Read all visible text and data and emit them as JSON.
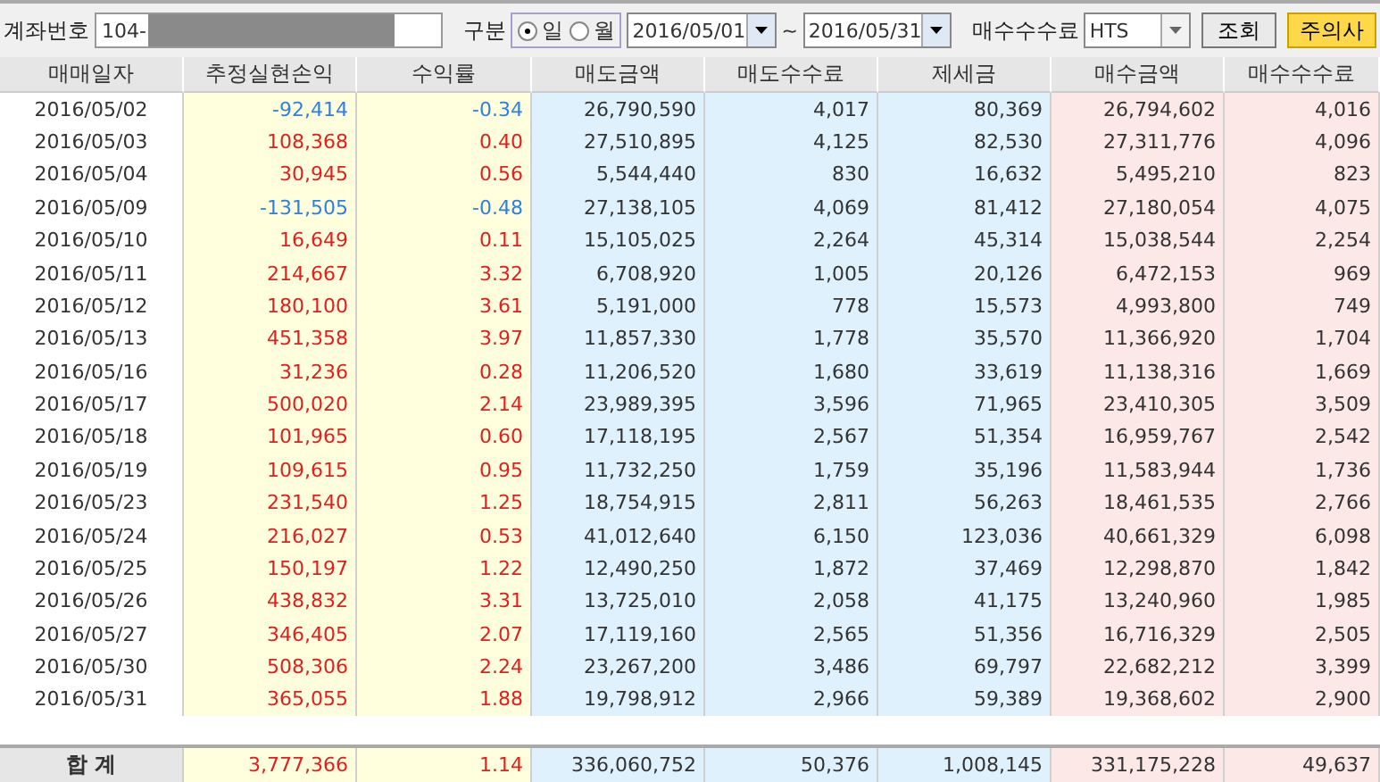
{
  "toolbar": {
    "account_label": "계좌번호",
    "account_value": "104-",
    "type_label": "구분",
    "period_options": [
      {
        "label": "일",
        "selected": true
      },
      {
        "label": "월",
        "selected": false
      }
    ],
    "date_from": "2016/05/01",
    "date_sep": "~",
    "date_to": "2016/05/31",
    "fee_label": "매수수수료",
    "fee_value": "HTS",
    "query_button": "조회",
    "notice_button": "주의사"
  },
  "table": {
    "columns": [
      "매매일자",
      "추정실현손익",
      "수익률",
      "매도금액",
      "매도수수료",
      "제세금",
      "매수금액",
      "매수수수료"
    ],
    "rows": [
      {
        "kind": "loss",
        "cells": [
          "2016/05/02",
          "-92,414",
          "-0.34",
          "26,790,590",
          "4,017",
          "80,369",
          "26,794,602",
          "4,016"
        ]
      },
      {
        "kind": "gain",
        "cells": [
          "2016/05/03",
          "108,368",
          "0.40",
          "27,510,895",
          "4,125",
          "82,530",
          "27,311,776",
          "4,096"
        ]
      },
      {
        "kind": "gain",
        "cells": [
          "2016/05/04",
          "30,945",
          "0.56",
          "5,544,440",
          "830",
          "16,632",
          "5,495,210",
          "823"
        ]
      },
      {
        "kind": "loss",
        "cells": [
          "2016/05/09",
          "-131,505",
          "-0.48",
          "27,138,105",
          "4,069",
          "81,412",
          "27,180,054",
          "4,075"
        ]
      },
      {
        "kind": "gain",
        "cells": [
          "2016/05/10",
          "16,649",
          "0.11",
          "15,105,025",
          "2,264",
          "45,314",
          "15,038,544",
          "2,254"
        ]
      },
      {
        "kind": "gain",
        "cells": [
          "2016/05/11",
          "214,667",
          "3.32",
          "6,708,920",
          "1,005",
          "20,126",
          "6,472,153",
          "969"
        ]
      },
      {
        "kind": "gain",
        "cells": [
          "2016/05/12",
          "180,100",
          "3.61",
          "5,191,000",
          "778",
          "15,573",
          "4,993,800",
          "749"
        ]
      },
      {
        "kind": "gain",
        "cells": [
          "2016/05/13",
          "451,358",
          "3.97",
          "11,857,330",
          "1,778",
          "35,570",
          "11,366,920",
          "1,704"
        ]
      },
      {
        "kind": "gain",
        "cells": [
          "2016/05/16",
          "31,236",
          "0.28",
          "11,206,520",
          "1,680",
          "33,619",
          "11,138,316",
          "1,669"
        ]
      },
      {
        "kind": "gain",
        "cells": [
          "2016/05/17",
          "500,020",
          "2.14",
          "23,989,395",
          "3,596",
          "71,965",
          "23,410,305",
          "3,509"
        ]
      },
      {
        "kind": "gain",
        "cells": [
          "2016/05/18",
          "101,965",
          "0.60",
          "17,118,195",
          "2,567",
          "51,354",
          "16,959,767",
          "2,542"
        ]
      },
      {
        "kind": "gain",
        "cells": [
          "2016/05/19",
          "109,615",
          "0.95",
          "11,732,250",
          "1,759",
          "35,196",
          "11,583,944",
          "1,736"
        ]
      },
      {
        "kind": "gain",
        "cells": [
          "2016/05/23",
          "231,540",
          "1.25",
          "18,754,915",
          "2,811",
          "56,263",
          "18,461,535",
          "2,766"
        ]
      },
      {
        "kind": "gain",
        "cells": [
          "2016/05/24",
          "216,027",
          "0.53",
          "41,012,640",
          "6,150",
          "123,036",
          "40,661,329",
          "6,098"
        ]
      },
      {
        "kind": "gain",
        "cells": [
          "2016/05/25",
          "150,197",
          "1.22",
          "12,490,250",
          "1,872",
          "37,469",
          "12,298,870",
          "1,842"
        ]
      },
      {
        "kind": "gain",
        "cells": [
          "2016/05/26",
          "438,832",
          "3.31",
          "13,725,010",
          "2,058",
          "41,175",
          "13,240,960",
          "1,985"
        ]
      },
      {
        "kind": "gain",
        "cells": [
          "2016/05/27",
          "346,405",
          "2.07",
          "17,119,160",
          "2,565",
          "51,356",
          "16,716,329",
          "2,505"
        ]
      },
      {
        "kind": "gain",
        "cells": [
          "2016/05/30",
          "508,306",
          "2.24",
          "23,267,200",
          "3,486",
          "69,797",
          "22,682,212",
          "3,399"
        ]
      },
      {
        "kind": "gain",
        "cells": [
          "2016/05/31",
          "365,055",
          "1.88",
          "19,798,912",
          "2,966",
          "59,389",
          "19,368,602",
          "2,900"
        ]
      }
    ],
    "total": {
      "kind": "gain",
      "cells": [
        "합 계",
        "3,777,366",
        "1.14",
        "336,060,752",
        "50,376",
        "1,008,145",
        "331,175,228",
        "49,637"
      ]
    }
  }
}
